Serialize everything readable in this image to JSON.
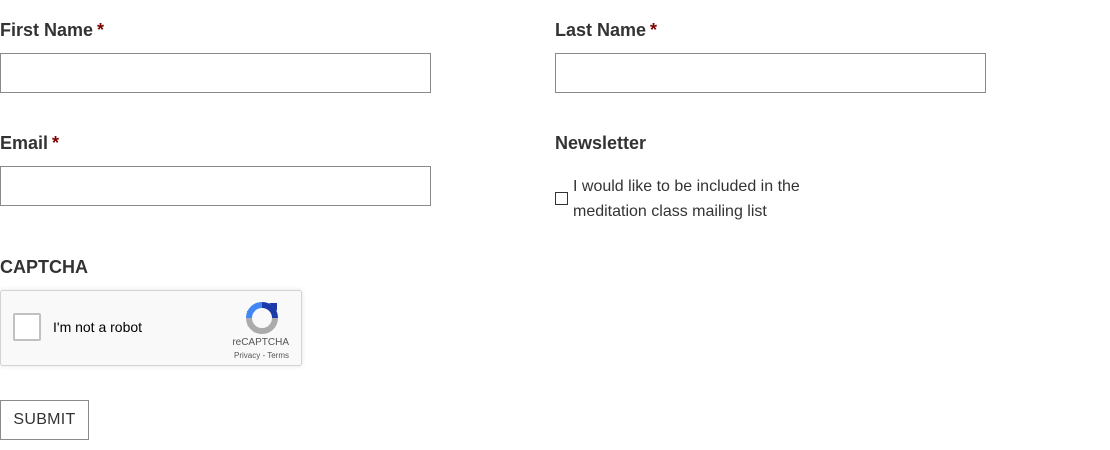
{
  "fields": {
    "first_name": {
      "label": "First Name",
      "required_mark": "*",
      "value": "",
      "placeholder": ""
    },
    "last_name": {
      "label": "Last Name",
      "required_mark": "*",
      "value": "",
      "placeholder": ""
    },
    "email": {
      "label": "Email",
      "required_mark": "*",
      "value": "",
      "placeholder": ""
    }
  },
  "newsletter": {
    "label": "Newsletter",
    "checkbox_label": "I would like to be included in the meditation class mailing list",
    "checked": false
  },
  "captcha": {
    "label": "CAPTCHA",
    "checkbox_text": "I'm not a robot",
    "brand": "reCAPTCHA",
    "privacy": "Privacy",
    "separator": " - ",
    "terms": "Terms",
    "icon": "recaptcha-logo-icon"
  },
  "submit": {
    "label": "SUBMIT"
  },
  "colors": {
    "text": "#333333",
    "required": "#7a0000",
    "border": "#8a8a8a",
    "recaptcha_blue": "#1c3aa9",
    "recaptcha_lightblue": "#4285f4",
    "recaptcha_gray": "#ababab"
  }
}
